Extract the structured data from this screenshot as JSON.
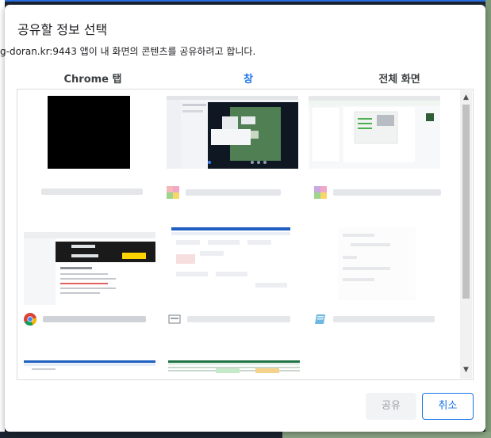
{
  "dialog": {
    "title": "공유할 정보 선택",
    "subtitle": "g-doran.kr:9443 앱이 내 화면의 콘텐츠를 공유하려고 합니다.",
    "tabs": [
      {
        "label": "Chrome 탭",
        "selected": false
      },
      {
        "label": "창",
        "selected": true
      },
      {
        "label": "전체 화면",
        "selected": false
      }
    ],
    "buttons": {
      "share_label": "공유",
      "cancel_label": "취소"
    }
  },
  "windows": [
    {
      "icon": "none"
    },
    {
      "icon": "app-icon"
    },
    {
      "icon": "app-icon"
    },
    {
      "icon": "chrome-icon"
    },
    {
      "icon": "window-icon"
    },
    {
      "icon": "notepad-icon"
    },
    {
      "icon": "none"
    },
    {
      "icon": "none"
    }
  ],
  "colors": {
    "accent": "#1a73e8",
    "text": "#202124",
    "border": "#dadce0"
  }
}
